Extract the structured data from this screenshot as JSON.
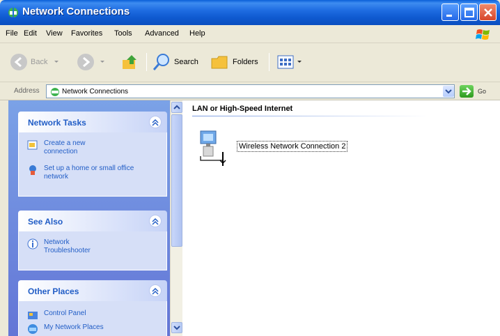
{
  "window": {
    "title": "Network Connections",
    "colors": {
      "titlebar": "#1f6de2",
      "taskpane": "#7ba2e7",
      "link": "#215dc6"
    }
  },
  "menu": [
    "File",
    "Edit",
    "View",
    "Favorites",
    "Tools",
    "Advanced",
    "Help"
  ],
  "toolbar": {
    "back_label": "Back",
    "search_label": "Search",
    "folders_label": "Folders"
  },
  "address": {
    "label": "Address",
    "value": "Network Connections",
    "go_label": "Go"
  },
  "sidebar": {
    "network_tasks": {
      "title": "Network Tasks",
      "items": [
        "Create a new connection",
        "Set up a home or small office network"
      ]
    },
    "see_also": {
      "title": "See Also",
      "items": [
        "Network Troubleshooter"
      ]
    },
    "other_places": {
      "title": "Other Places",
      "items": [
        "Control Panel",
        "My Network Places"
      ]
    }
  },
  "content": {
    "group_title": "LAN or High-Speed Internet",
    "connections": [
      "Wireless Network Connection 2"
    ]
  }
}
